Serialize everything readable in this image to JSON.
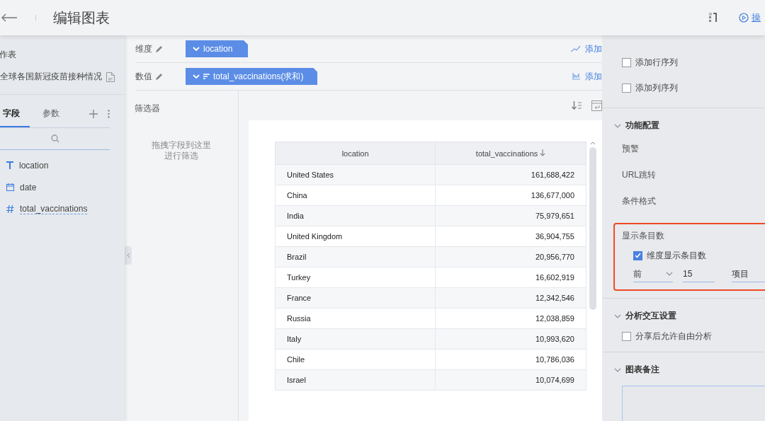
{
  "header": {
    "title": "编辑图表",
    "action_link": "操"
  },
  "sidebar": {
    "section_label": "作表",
    "dataset": "全球各国新冠疫苗接种情况",
    "tabs": [
      {
        "label": "字段",
        "selected": true
      },
      {
        "label": "参数",
        "selected": false
      }
    ],
    "fields": [
      {
        "kind": "text",
        "name": "location"
      },
      {
        "kind": "date",
        "name": "date"
      },
      {
        "kind": "number",
        "name": "total_vaccinations"
      }
    ]
  },
  "shelves": [
    {
      "label": "维度",
      "kind": "dimension",
      "pill": "location",
      "add_label": "添加"
    },
    {
      "label": "数值",
      "kind": "measure",
      "pill": "total_vaccinations(求和)",
      "add_label": "添加"
    }
  ],
  "filter": {
    "label": "筛选器",
    "hint_lines": [
      "拖拽字段到这里",
      "进行筛选"
    ]
  },
  "table": {
    "columns": [
      {
        "label": "location",
        "sorted": false
      },
      {
        "label": "total_vaccinations",
        "sorted": true
      }
    ],
    "rows": [
      [
        "United States",
        "161,688,422"
      ],
      [
        "China",
        "136,677,000"
      ],
      [
        "India",
        "75,979,651"
      ],
      [
        "United Kingdom",
        "36,904,755"
      ],
      [
        "Brazil",
        "20,956,770"
      ],
      [
        "Turkey",
        "16,602,919"
      ],
      [
        "France",
        "12,342,546"
      ],
      [
        "Russia",
        "12,038,859"
      ],
      [
        "Italy",
        "10,993,620"
      ],
      [
        "Chile",
        "10,786,036"
      ],
      [
        "Israel",
        "10,074,699"
      ]
    ]
  },
  "settings": {
    "checkboxes": [
      {
        "label": "添加行序列",
        "checked": false
      },
      {
        "label": "添加列序列",
        "checked": false
      }
    ],
    "function_config": {
      "title": "功能配置",
      "items": [
        "预警",
        "URL跳转",
        "条件格式"
      ]
    },
    "display_count": {
      "title": "显示条目数",
      "checkbox": {
        "label": "维度显示条目数",
        "checked": true
      },
      "direction": "前",
      "count": "15",
      "unit": "项目"
    },
    "interaction": {
      "title": "分析交互设置",
      "checkbox": {
        "label": "分享后允许自由分析",
        "checked": false
      }
    },
    "notes": {
      "title": "图表备注"
    }
  }
}
